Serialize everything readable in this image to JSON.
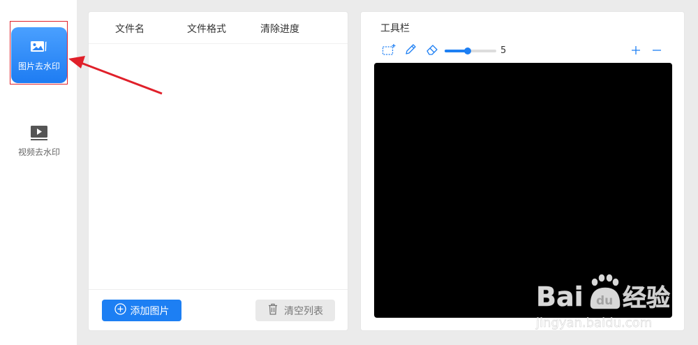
{
  "sidebar": {
    "items": [
      {
        "label": "图片去水印",
        "icon": "image-icon",
        "active": true
      },
      {
        "label": "视频去水印",
        "icon": "video-play-icon",
        "active": false
      }
    ]
  },
  "file_table": {
    "columns": [
      "文件名",
      "文件格式",
      "清除进度"
    ],
    "rows": []
  },
  "footer": {
    "add_label": "添加图片",
    "clear_label": "清空列表"
  },
  "toolbar": {
    "title": "工具栏",
    "brush_size": "5",
    "brush_size_fraction": 0.45,
    "tools": [
      "rect-select-icon",
      "pencil-icon",
      "eraser-icon",
      "zoom-in-icon",
      "zoom-out-icon"
    ]
  },
  "colors": {
    "accent": "#1d7ff3",
    "canvas": "#000000",
    "annotation": "#e0202a"
  },
  "watermark": {
    "brand_latin": "Bai",
    "brand_du": "du",
    "brand_cn": "经验",
    "url": "jingyan.baidu.com"
  }
}
